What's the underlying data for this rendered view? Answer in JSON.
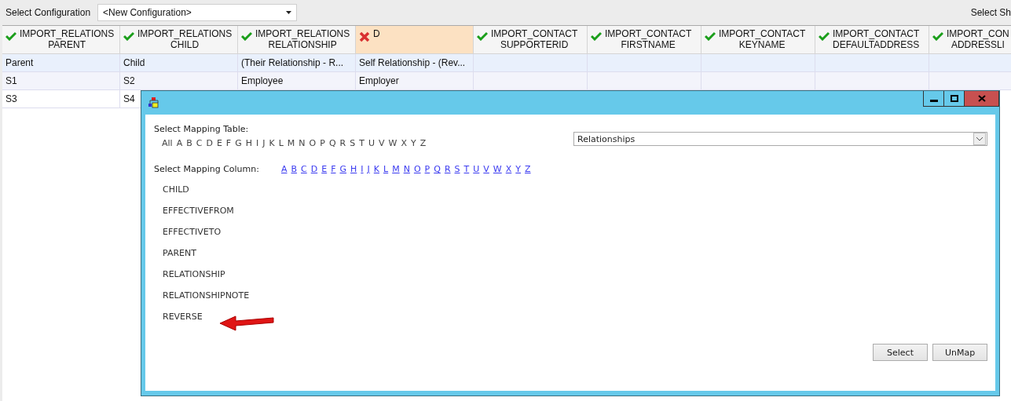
{
  "top_bar": {
    "label": "Select Configuration",
    "configuration": "<New Configuration>",
    "right_label": "Select Sh"
  },
  "grid": {
    "columns": [
      {
        "line1": "IMPORT_RELATIONS",
        "line2": "PARENT",
        "mapped": true
      },
      {
        "line1": "IMPORT_RELATIONS",
        "line2": "CHILD",
        "mapped": true
      },
      {
        "line1": "IMPORT_RELATIONS",
        "line2": "RELATIONSHIP",
        "mapped": true
      },
      {
        "line1": "D",
        "mapped": false
      },
      {
        "line1": "IMPORT_CONTACT",
        "line2": "SUPPORTERID",
        "mapped": true
      },
      {
        "line1": "IMPORT_CONTACT",
        "line2": "FIRSTNAME",
        "mapped": true
      },
      {
        "line1": "IMPORT_CONTACT",
        "line2": "KEYNAME",
        "mapped": true
      },
      {
        "line1": "IMPORT_CONTACT",
        "line2": "DEFAULTADDRESS",
        "mapped": true
      },
      {
        "line1": "IMPORT_CON",
        "line2": "ADDRESSLI",
        "mapped": true
      }
    ],
    "rows": [
      {
        "cells": [
          "Parent",
          "Child",
          "(Their Relationship - R...",
          "Self Relationship - (Rev..."
        ]
      },
      {
        "cells": [
          "S1",
          "S2",
          "Employee",
          "Employer"
        ]
      },
      {
        "cells": [
          "S3",
          "S4"
        ]
      }
    ]
  },
  "dialog": {
    "table_label": "Select Mapping Table:",
    "table_letters": [
      "All",
      "A",
      "B",
      "C",
      "D",
      "E",
      "F",
      "G",
      "H",
      "I",
      "J",
      "K",
      "L",
      "M",
      "N",
      "O",
      "P",
      "Q",
      "R",
      "S",
      "T",
      "U",
      "V",
      "W",
      "X",
      "Y",
      "Z"
    ],
    "table_value": "Relationships",
    "column_label": "Select Mapping Column:",
    "column_letters": [
      "A",
      "B",
      "C",
      "D",
      "E",
      "F",
      "G",
      "H",
      "I",
      "J",
      "K",
      "L",
      "M",
      "N",
      "O",
      "P",
      "Q",
      "R",
      "S",
      "T",
      "U",
      "V",
      "W",
      "X",
      "Y",
      "Z"
    ],
    "columns": [
      "CHILD",
      "EFFECTIVEFROM",
      "EFFECTIVETO",
      "PARENT",
      "RELATIONSHIP",
      "RELATIONSHIPNOTE",
      "REVERSE"
    ],
    "buttons": [
      "Select",
      "UnMap"
    ]
  }
}
